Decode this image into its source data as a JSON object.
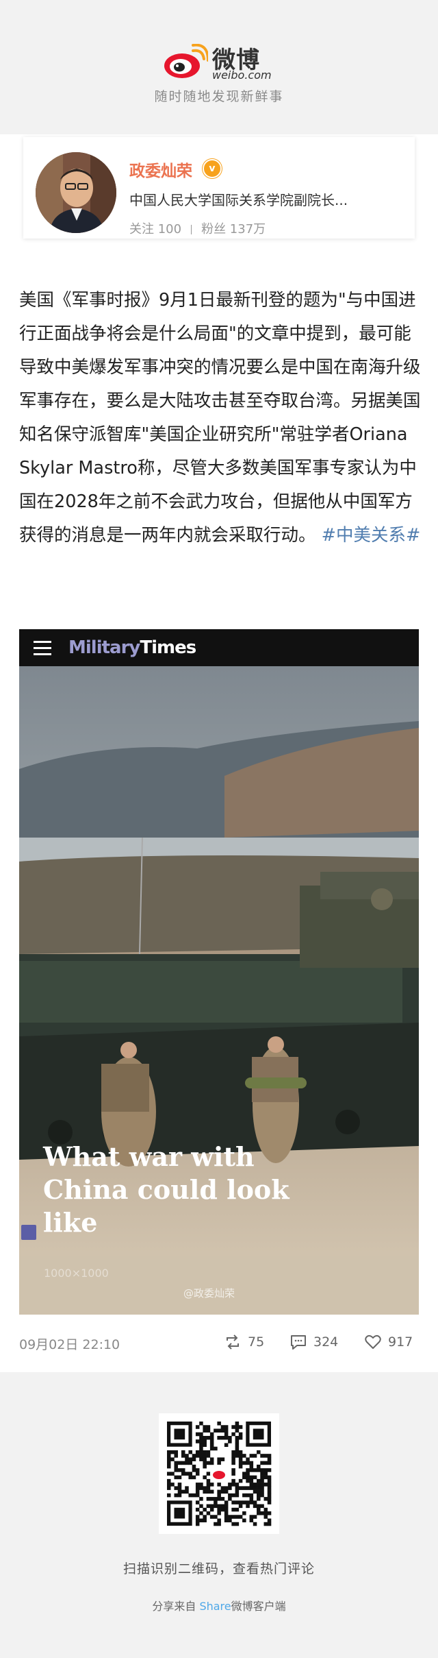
{
  "brand": {
    "logo_cn": "微博",
    "logo_en": "weibo.com",
    "tagline": "随时随地发现新鲜事"
  },
  "profile": {
    "name": "政委灿荣",
    "title": "中国人民大学国际关系学院副院长...",
    "follow_label": "关注 100",
    "fans_label": "粉丝 137万",
    "verified_color": "#f7a21d",
    "name_color": "#eb7350"
  },
  "post": {
    "text": "美国《军事时报》9月1日最新刊登的题为\"与中国进行正面战争将会是什么局面\"的文章中提到，最可能导致中美爆发军事冲突的情况要么是中国在南海升级军事存在，要么是大陆攻击甚至夺取台湾。另据美国知名保守派智库\"美国企业研究所\"常驻学者Oriana Skylar Mastro称，尽管大多数美国军事专家认为中国在2028年之前不会武力攻台，但据他从中国军方获得的消息是一两年内就会采取行动。",
    "hashtag": "#中美关系#",
    "hashtag_color": "#507daf"
  },
  "media": {
    "site_name_part1": "Military",
    "site_name_part2": "Times",
    "headline": "What war with China could look like",
    "credit": "1000×1000",
    "watermark": "@政委灿荣"
  },
  "meta": {
    "date": "09月02日 22:10",
    "reposts": "75",
    "comments": "324",
    "likes": "917"
  },
  "footer": {
    "scan_text": "扫描识别二维码，查看热门评论",
    "share_prefix": "分享来自",
    "share_highlight": "Share",
    "share_suffix": "微博客户端"
  },
  "icons": {
    "logo": "weibo-eye-logo",
    "verified": "verified-badge-icon",
    "menu": "hamburger-menu-icon",
    "repost": "repost-icon",
    "comment": "comment-icon",
    "like": "heart-icon",
    "qr": "qr-code"
  }
}
